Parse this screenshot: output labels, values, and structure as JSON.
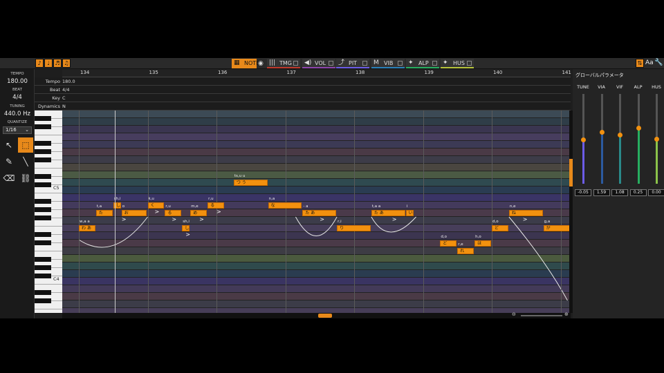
{
  "toolbar": {
    "left_icons": [
      "note-tool-icon",
      "timing-tool-icon",
      "pitch-tool-icon",
      "phoneme-tool-icon"
    ],
    "tabs": [
      {
        "label": "NOTE",
        "icon": "▦",
        "color": "#e8891a"
      },
      {
        "label": "TMG",
        "icon": "|||",
        "color": "#c0392b"
      },
      {
        "label": "VOL",
        "icon": "◀)",
        "color": "#8e44ad"
      },
      {
        "label": "PIT",
        "icon": "⤴",
        "color": "#6c5ce7"
      },
      {
        "label": "VIB",
        "icon": "M",
        "color": "#2980b9"
      },
      {
        "label": "ALP",
        "icon": "✦",
        "color": "#27ae60"
      },
      {
        "label": "HUS",
        "icon": "✦",
        "color": "#b7c43a"
      }
    ],
    "right_text": "Aa"
  },
  "left": {
    "tempo_label": "TEMPO",
    "tempo_value": "180.00",
    "beat_label": "BEAT",
    "beat_value": "4/4",
    "tuning_label": "TUNING",
    "tuning_value": "440.0 Hz",
    "quantize_label": "QUANTIZE",
    "quantize_value": "1/16"
  },
  "ruler": {
    "bars": [
      "134",
      "135",
      "136",
      "137",
      "138",
      "139",
      "140",
      "141"
    ]
  },
  "control_rows": [
    {
      "name": "Tempo",
      "value": "180.0"
    },
    {
      "name": "Beat",
      "value": "4/4"
    },
    {
      "name": "Key",
      "value": "C"
    },
    {
      "name": "Dynamics",
      "value": "N"
    }
  ],
  "keys": {
    "c5": "C5",
    "c4": "C4"
  },
  "notes": [
    {
      "lyric": "わ あ",
      "ph": "w,a  a",
      "bar": 134.0,
      "len": 0.25,
      "row": 15
    },
    {
      "lyric": "た",
      "ph": "t,a",
      "bar": 134.25,
      "len": 0.25,
      "row": 13
    },
    {
      "lyric": "し",
      "ph": "sh,i",
      "bar": 134.5,
      "len": 0.12,
      "row": 12
    },
    {
      "lyric": "お",
      "ph": "o",
      "bar": 134.62,
      "len": 0.38,
      "row": 13
    },
    {
      "lyric": "く",
      "ph": "k,u",
      "bar": 135.0,
      "len": 0.25,
      "row": 12
    },
    {
      "lyric": "る",
      "ph": "r,u",
      "bar": 135.25,
      "len": 0.25,
      "row": 13
    },
    {
      "lyric": "し",
      "ph": "sh,i",
      "bar": 135.5,
      "len": 0.12,
      "row": 15
    },
    {
      "lyric": "め",
      "ph": "m,e",
      "bar": 135.62,
      "len": 0.25,
      "row": 13
    },
    {
      "lyric": "る",
      "ph": "r,u",
      "bar": 135.87,
      "len": 0.25,
      "row": 12
    },
    {
      "lyric": "つ う",
      "ph": "ts,u  u",
      "bar": 136.25,
      "len": 0.5,
      "row": 9
    },
    {
      "lyric": "な",
      "ph": "n,a",
      "bar": 136.75,
      "len": 0.5,
      "row": 12
    },
    {
      "lyric": "た あ",
      "ph": "-  a",
      "bar": 137.25,
      "len": 0.5,
      "row": 13
    },
    {
      "lyric": "り",
      "ph": "r,i",
      "bar": 137.75,
      "len": 0.5,
      "row": 15
    },
    {
      "lyric": "た あ",
      "ph": "t,a   a",
      "bar": 138.25,
      "len": 0.5,
      "row": 13
    },
    {
      "lyric": "い",
      "ph": "i",
      "bar": 138.75,
      "len": 0.12,
      "row": 13
    },
    {
      "lyric": "ど",
      "ph": "d,o",
      "bar": 139.25,
      "len": 0.25,
      "row": 17
    },
    {
      "lyric": "れ",
      "ph": "r,e",
      "bar": 139.5,
      "len": 0.25,
      "row": 18
    },
    {
      "lyric": "ほ",
      "ph": "h,o",
      "bar": 139.75,
      "len": 0.25,
      "row": 17
    },
    {
      "lyric": "ど",
      "ph": "d,o",
      "bar": 140.0,
      "len": 0.25,
      "row": 15
    },
    {
      "lyric": "ね",
      "ph": "n,e",
      "bar": 140.25,
      "len": 0.5,
      "row": 13
    },
    {
      "lyric": "が",
      "ph": "g,a",
      "bar": 140.75,
      "len": 0.4,
      "row": 15
    }
  ],
  "params": {
    "title": "グローバルパラメータ",
    "items": [
      {
        "name": "TUNE",
        "value": "-0.05",
        "level": 0.49,
        "color": "#6c5ce7"
      },
      {
        "name": "VIA",
        "value": "1.59",
        "level": 0.58,
        "color": "#2c5aa0"
      },
      {
        "name": "VIF",
        "value": "1.08",
        "level": 0.55,
        "color": "#2a8a8a"
      },
      {
        "name": "ALP",
        "value": "0.25",
        "level": 0.62,
        "color": "#27ae60"
      },
      {
        "name": "HUS",
        "value": "0.00",
        "level": 0.5,
        "color": "#8bc34a"
      }
    ]
  }
}
